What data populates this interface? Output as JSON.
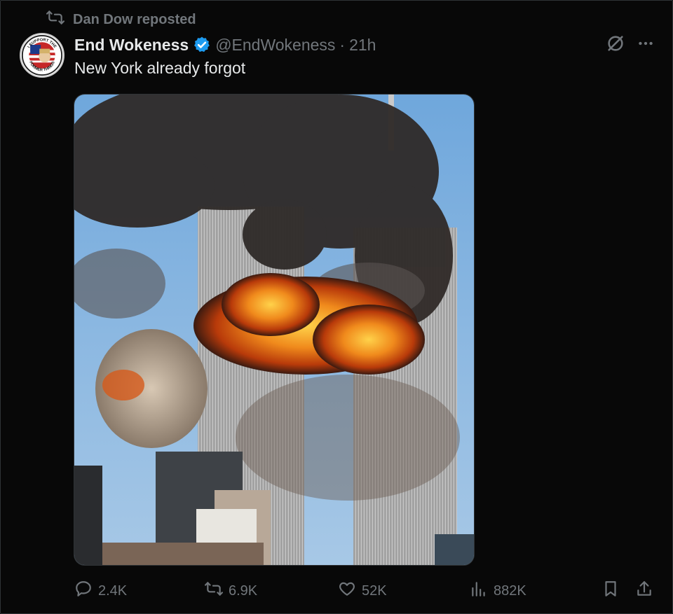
{
  "repost": {
    "label": "Dan Dow reposted",
    "icon": "repost-icon"
  },
  "post": {
    "display_name": "End Wokeness",
    "handle": "@EndWokeness",
    "separator": "·",
    "time": "21h",
    "text": "New York already forgot",
    "avatar_text_top": "I SUPPORT THE",
    "avatar_text_bottom": "FORMER THINGS"
  },
  "actions": {
    "replies": "2.4K",
    "reposts": "6.9K",
    "likes": "52K",
    "views": "882K"
  },
  "colors": {
    "background": "#000000",
    "text_primary": "#e7e9ea",
    "text_secondary": "#71767b",
    "verified": "#1d9bf0"
  }
}
